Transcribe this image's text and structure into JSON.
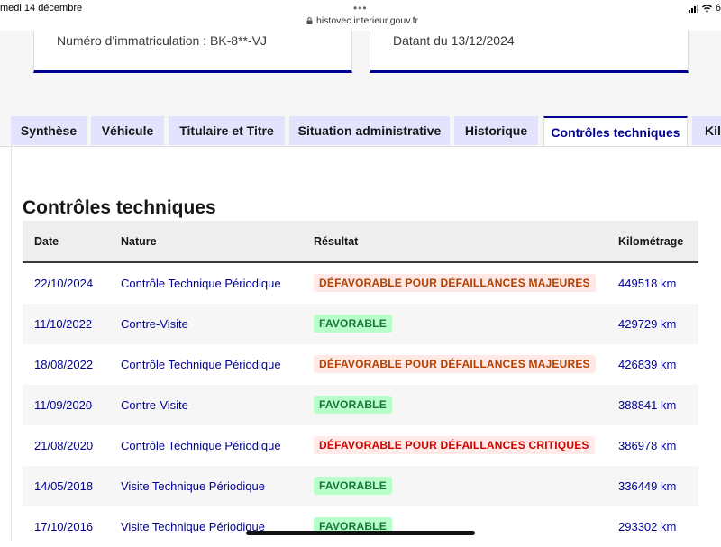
{
  "status_bar": {
    "date": "medi 14 décembre",
    "dots": "•••",
    "url": "histovec.interieur.gouv.fr",
    "battery": "6"
  },
  "cards": {
    "left_text": "Numéro d'immatriculation : BK-8**-VJ",
    "right_text": "Datant du 13/12/2024"
  },
  "tabs": [
    {
      "label": "Synthèse"
    },
    {
      "label": "Véhicule"
    },
    {
      "label": "Titulaire et Titre"
    },
    {
      "label": "Situation administrative"
    },
    {
      "label": "Historique"
    },
    {
      "label": "Contrôles techniques",
      "active": true
    },
    {
      "label": "Kil"
    }
  ],
  "section": {
    "title": "Contrôles techniques"
  },
  "table": {
    "headers": {
      "date": "Date",
      "nature": "Nature",
      "result": "Résultat",
      "km": "Kilométrage"
    },
    "rows": [
      {
        "date": "22/10/2024",
        "nature": "Contrôle Technique Périodique",
        "result": "DÉFAVORABLE POUR DÉFAILLANCES MAJEURES",
        "result_type": "warn",
        "km": "449518 km"
      },
      {
        "date": "11/10/2022",
        "nature": "Contre-Visite",
        "result": "FAVORABLE",
        "result_type": "ok",
        "km": "429729 km"
      },
      {
        "date": "18/08/2022",
        "nature": "Contrôle Technique Périodique",
        "result": "DÉFAVORABLE POUR DÉFAILLANCES MAJEURES",
        "result_type": "warn",
        "km": "426839 km"
      },
      {
        "date": "11/09/2020",
        "nature": "Contre-Visite",
        "result": "FAVORABLE",
        "result_type": "ok",
        "km": "388841 km"
      },
      {
        "date": "21/08/2020",
        "nature": "Contrôle Technique Périodique",
        "result": "DÉFAVORABLE POUR DÉFAILLANCES CRITIQUES",
        "result_type": "crit",
        "km": "386978 km"
      },
      {
        "date": "14/05/2018",
        "nature": "Visite Technique Périodique",
        "result": "FAVORABLE",
        "result_type": "ok",
        "km": "336449 km"
      },
      {
        "date": "17/10/2016",
        "nature": "Visite Technique Périodique",
        "result": "FAVORABLE",
        "result_type": "ok",
        "km": "293302 km"
      }
    ]
  },
  "colors": {
    "accent": "#000091",
    "warn": "#b34000",
    "ok": "#18753c",
    "crit": "#ce0500"
  }
}
